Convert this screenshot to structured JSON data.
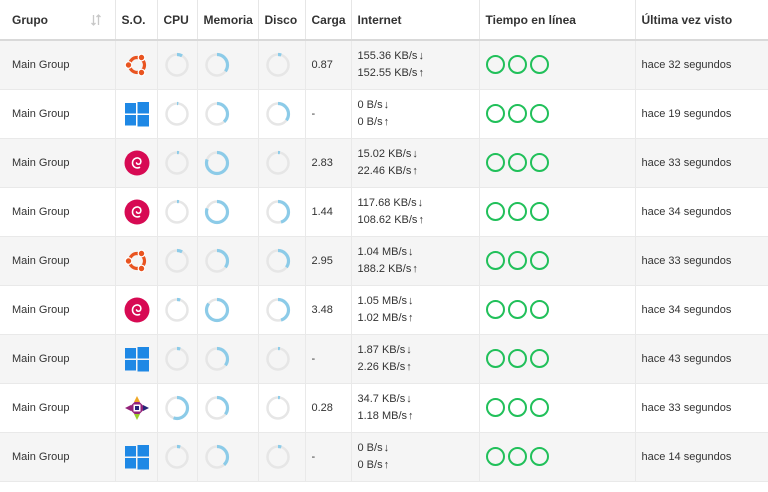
{
  "colors": {
    "online": "#21c05a",
    "gauge_fill": "#8ccbe8",
    "gauge_track": "#e6e6e6",
    "ubuntu": "#e95420",
    "debian": "#d70a53",
    "windows": "#1e88e5"
  },
  "headers": {
    "grupo": "Grupo",
    "os": "S.O.",
    "cpu": "CPU",
    "memoria": "Memoria",
    "disco": "Disco",
    "carga": "Carga",
    "internet": "Internet",
    "tiempo": "Tiempo en línea",
    "ultima": "Última vez visto"
  },
  "rows": [
    {
      "group": "Main Group",
      "os": "ubuntu-icon",
      "cpu": 0.08,
      "mem": 0.35,
      "disk": 0.05,
      "load": "0.87",
      "down": "155.36 KB/s",
      "up": "152.55 KB/s",
      "arrow_down": "↓",
      "arrow_up": "↑",
      "seen": "hace 32 segundos"
    },
    {
      "group": "Main Group",
      "os": "windows-icon",
      "cpu": 0.02,
      "mem": 0.38,
      "disk": 0.35,
      "load": "-",
      "down": "0 B/s",
      "up": "0 B/s",
      "arrow_down": "↓",
      "arrow_up": "↑",
      "seen": "hace 19 segundos"
    },
    {
      "group": "Main Group",
      "os": "debian-icon",
      "cpu": 0.03,
      "mem": 0.8,
      "disk": 0.03,
      "load": "2.83",
      "down": "15.02 KB/s",
      "up": "22.46 KB/s",
      "arrow_down": "↓",
      "arrow_up": "↑",
      "seen": "hace 33 segundos"
    },
    {
      "group": "Main Group",
      "os": "debian-icon",
      "cpu": 0.03,
      "mem": 0.8,
      "disk": 0.45,
      "load": "1.44",
      "down": "117.68 KB/s",
      "up": "108.62 KB/s",
      "arrow_down": "↓",
      "arrow_up": "↑",
      "seen": "hace 34 segundos"
    },
    {
      "group": "Main Group",
      "os": "ubuntu-icon",
      "cpu": 0.08,
      "mem": 0.35,
      "disk": 0.35,
      "load": "2.95",
      "down": "1.04 MB/s",
      "up": "188.2 KB/s",
      "arrow_down": "↓",
      "arrow_up": "↑",
      "seen": "hace 33 segundos"
    },
    {
      "group": "Main Group",
      "os": "debian-icon",
      "cpu": 0.05,
      "mem": 0.85,
      "disk": 0.45,
      "load": "3.48",
      "down": "1.05 MB/s",
      "up": "1.02 MB/s",
      "arrow_down": "↓",
      "arrow_up": "↑",
      "seen": "hace 34 segundos"
    },
    {
      "group": "Main Group",
      "os": "windows-icon",
      "cpu": 0.05,
      "mem": 0.35,
      "disk": 0.03,
      "load": "-",
      "down": "1.87 KB/s",
      "up": "2.26 KB/s",
      "arrow_down": "↓",
      "arrow_up": "↑",
      "seen": "hace 43 segundos"
    },
    {
      "group": "Main Group",
      "os": "centos-icon",
      "cpu": 0.55,
      "mem": 0.35,
      "disk": 0.03,
      "load": "0.28",
      "down": "34.7 KB/s",
      "up": "1.18 MB/s",
      "arrow_down": "↓",
      "arrow_up": "↑",
      "seen": "hace 33 segundos"
    },
    {
      "group": "Main Group",
      "os": "windows-icon",
      "cpu": 0.05,
      "mem": 0.38,
      "disk": 0.05,
      "load": "-",
      "down": "0 B/s",
      "up": "0 B/s",
      "arrow_down": "↓",
      "arrow_up": "↑",
      "seen": "hace 14 segundos"
    }
  ]
}
